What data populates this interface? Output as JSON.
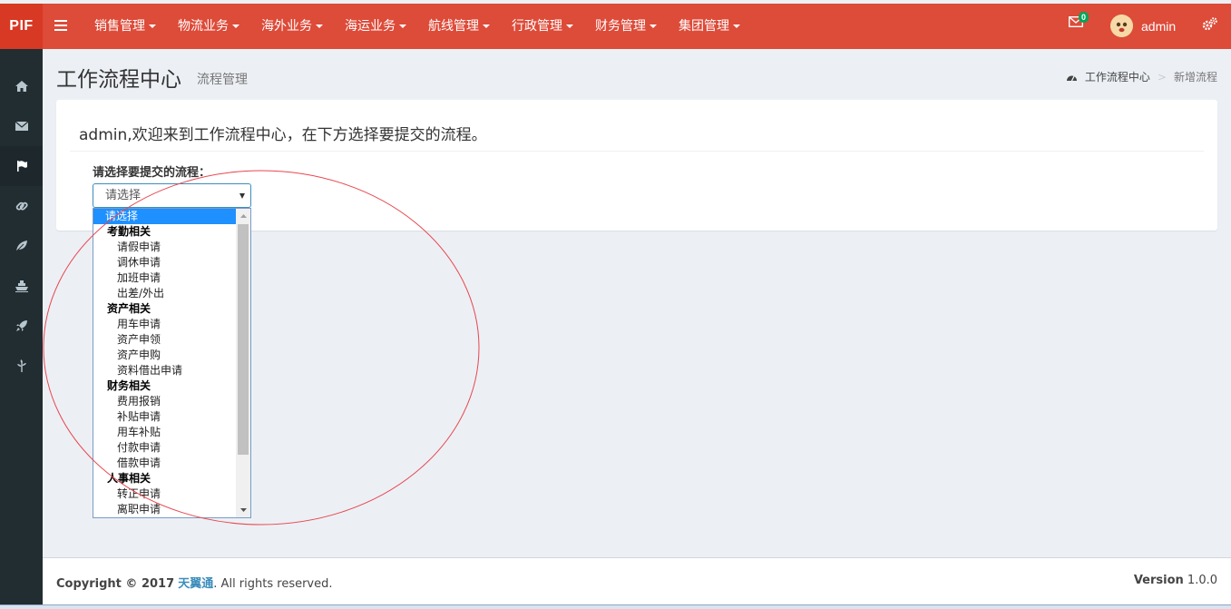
{
  "brand": {
    "logo_text": "PIF"
  },
  "topnav": {
    "items": [
      {
        "label": "销售管理"
      },
      {
        "label": "物流业务"
      },
      {
        "label": "海外业务"
      },
      {
        "label": "海运业务"
      },
      {
        "label": "航线管理"
      },
      {
        "label": "行政管理"
      },
      {
        "label": "财务管理"
      },
      {
        "label": "集团管理"
      }
    ],
    "mail_count": "0",
    "username": "admin",
    "icons": [
      "menu-icon",
      "mail-icon",
      "avatar",
      "gears-icon"
    ]
  },
  "sidebar": {
    "icons": [
      "home-icon",
      "envelope-icon",
      "flag-icon",
      "link-icon",
      "leaf-icon",
      "ship-icon",
      "rocket-icon",
      "pagelines-icon"
    ],
    "active_index": 2
  },
  "header": {
    "title": "工作流程中心",
    "subtitle": "流程管理",
    "breadcrumb": {
      "home": "工作流程中心",
      "current": "新增流程"
    }
  },
  "main": {
    "welcome": "admin,欢迎来到工作流程中心，在下方选择要提交的流程。",
    "select_label": "请选择要提交的流程：",
    "select_value": "请选择",
    "options": [
      {
        "type": "selected",
        "label": "请选择"
      },
      {
        "type": "group",
        "label": "考勤相关"
      },
      {
        "type": "item",
        "label": "请假申请"
      },
      {
        "type": "item",
        "label": "调休申请"
      },
      {
        "type": "item",
        "label": "加班申请"
      },
      {
        "type": "item",
        "label": "出差/外出"
      },
      {
        "type": "group",
        "label": "资产相关"
      },
      {
        "type": "item",
        "label": "用车申请"
      },
      {
        "type": "item",
        "label": "资产申领"
      },
      {
        "type": "item",
        "label": "资产申购"
      },
      {
        "type": "item",
        "label": "资料借出申请"
      },
      {
        "type": "group",
        "label": "财务相关"
      },
      {
        "type": "item",
        "label": "费用报销"
      },
      {
        "type": "item",
        "label": "补贴申请"
      },
      {
        "type": "item",
        "label": "用车补贴"
      },
      {
        "type": "item",
        "label": "付款申请"
      },
      {
        "type": "item",
        "label": "借款申请"
      },
      {
        "type": "group",
        "label": "人事相关"
      },
      {
        "type": "item",
        "label": "转正申请"
      },
      {
        "type": "item",
        "label": "离职申请"
      }
    ]
  },
  "footer": {
    "copyright_prefix": "Copyright © 2017",
    "company": "天翼通",
    "copyright_suffix": ". All rights reserved.",
    "version_label": "Version",
    "version_value": "1.0.0"
  },
  "colors": {
    "topbar": "#dd4b39",
    "sidebar": "#222d32",
    "annotation": "#e8474f",
    "accent": "#3c8dbc"
  }
}
